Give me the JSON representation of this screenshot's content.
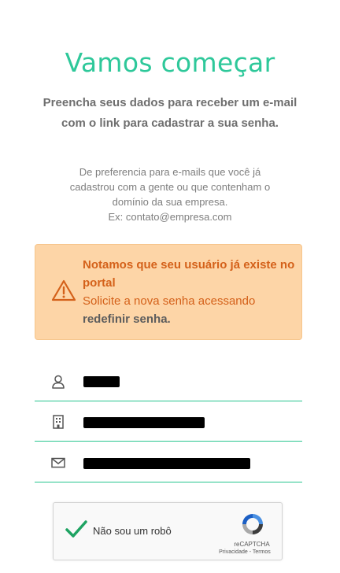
{
  "header": {
    "title": "Vamos começar",
    "subtitle": "Preencha seus dados para receber um e-mail com o link para cadastrar a sua senha."
  },
  "hint": {
    "line1": "De preferencia para e-mails que você já",
    "line2": "cadastrou com a gente ou que contenham o",
    "line3": "domínio da sua empresa.",
    "line4": "Ex: contato@empresa.com"
  },
  "alert": {
    "heading": "Notamos que seu usuário já existe no portal",
    "body": "Solicite a nova senha acessando ",
    "link": "redefinir senha.",
    "icon": "warning-triangle-icon",
    "colors": {
      "background": "#fdd5a7",
      "text": "#d4611a"
    }
  },
  "form": {
    "user_field": {
      "icon": "user-icon",
      "value_redacted": true
    },
    "company_field": {
      "icon": "building-icon",
      "value_redacted": true
    },
    "email_field": {
      "icon": "mail-icon",
      "value_redacted": true
    },
    "underline_color": "#27c58f"
  },
  "captcha": {
    "label": "Não sou um robô",
    "checked": true,
    "brand": "reCAPTCHA",
    "privacy": "Privacidade",
    "separator": " - ",
    "terms": "Termos"
  },
  "colors": {
    "accent": "#2ec89a"
  }
}
